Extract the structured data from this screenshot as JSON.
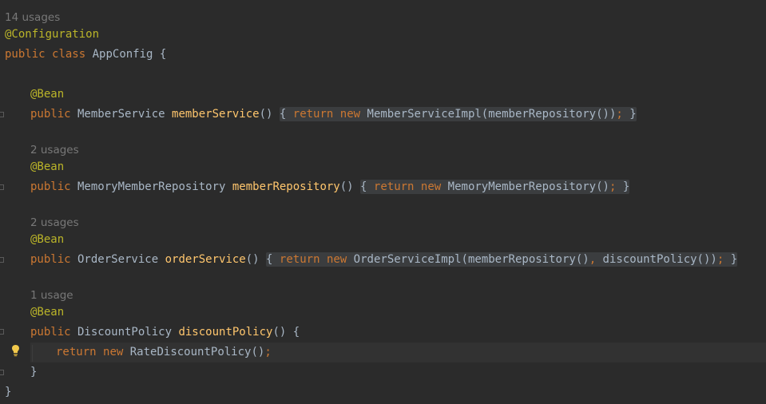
{
  "editor": {
    "class_usages": "14 usages",
    "class_annotation": "@Configuration",
    "class_kw_public": "public",
    "class_kw_class": "class",
    "class_name_line": " AppConfig {",
    "bean_annotation": "@Bean",
    "kw_public": "public",
    "kw_return": "return",
    "kw_new": "new",
    "m1": {
      "return_type": " MemberService ",
      "name": "memberService",
      "params": "()",
      "fold_open": "{",
      "impl_call": "MemberServiceImpl(memberRepository())",
      "semicolon": ";",
      "fold_close": "}"
    },
    "m2": {
      "usages": "2 usages",
      "return_type": " MemoryMemberRepository ",
      "name": "memberRepository",
      "params": "()",
      "fold_open": "{",
      "impl_call": "MemoryMemberRepository()",
      "semicolon": ";",
      "fold_close": "}"
    },
    "m3": {
      "usages": "2 usages",
      "return_type": " OrderService ",
      "name": "orderService",
      "params": "()",
      "fold_open": "{",
      "impl_call_a": "OrderServiceImpl(memberRepository()",
      "comma": ",",
      "impl_call_b": " discountPolicy())",
      "semicolon": ";",
      "fold_close": "}"
    },
    "m4": {
      "usages": "1 usage",
      "return_type": " DiscountPolicy ",
      "name": "discountPolicy",
      "params": "() {",
      "body_call": "RateDiscountPolicy()",
      "semicolon": ";",
      "close_brace": "}"
    },
    "class_close": "}"
  },
  "icons": {
    "intention_bulb": "lightbulb-icon",
    "fold_marker": "fold-marker-icon"
  },
  "colors": {
    "background": "#2b2b2b",
    "keyword": "#cc7832",
    "annotation": "#bbb529",
    "method_declaration": "#ffc66d",
    "plain_text": "#a9b7c6",
    "inlay_hint": "#787878",
    "bulb": "#f2c94c"
  }
}
